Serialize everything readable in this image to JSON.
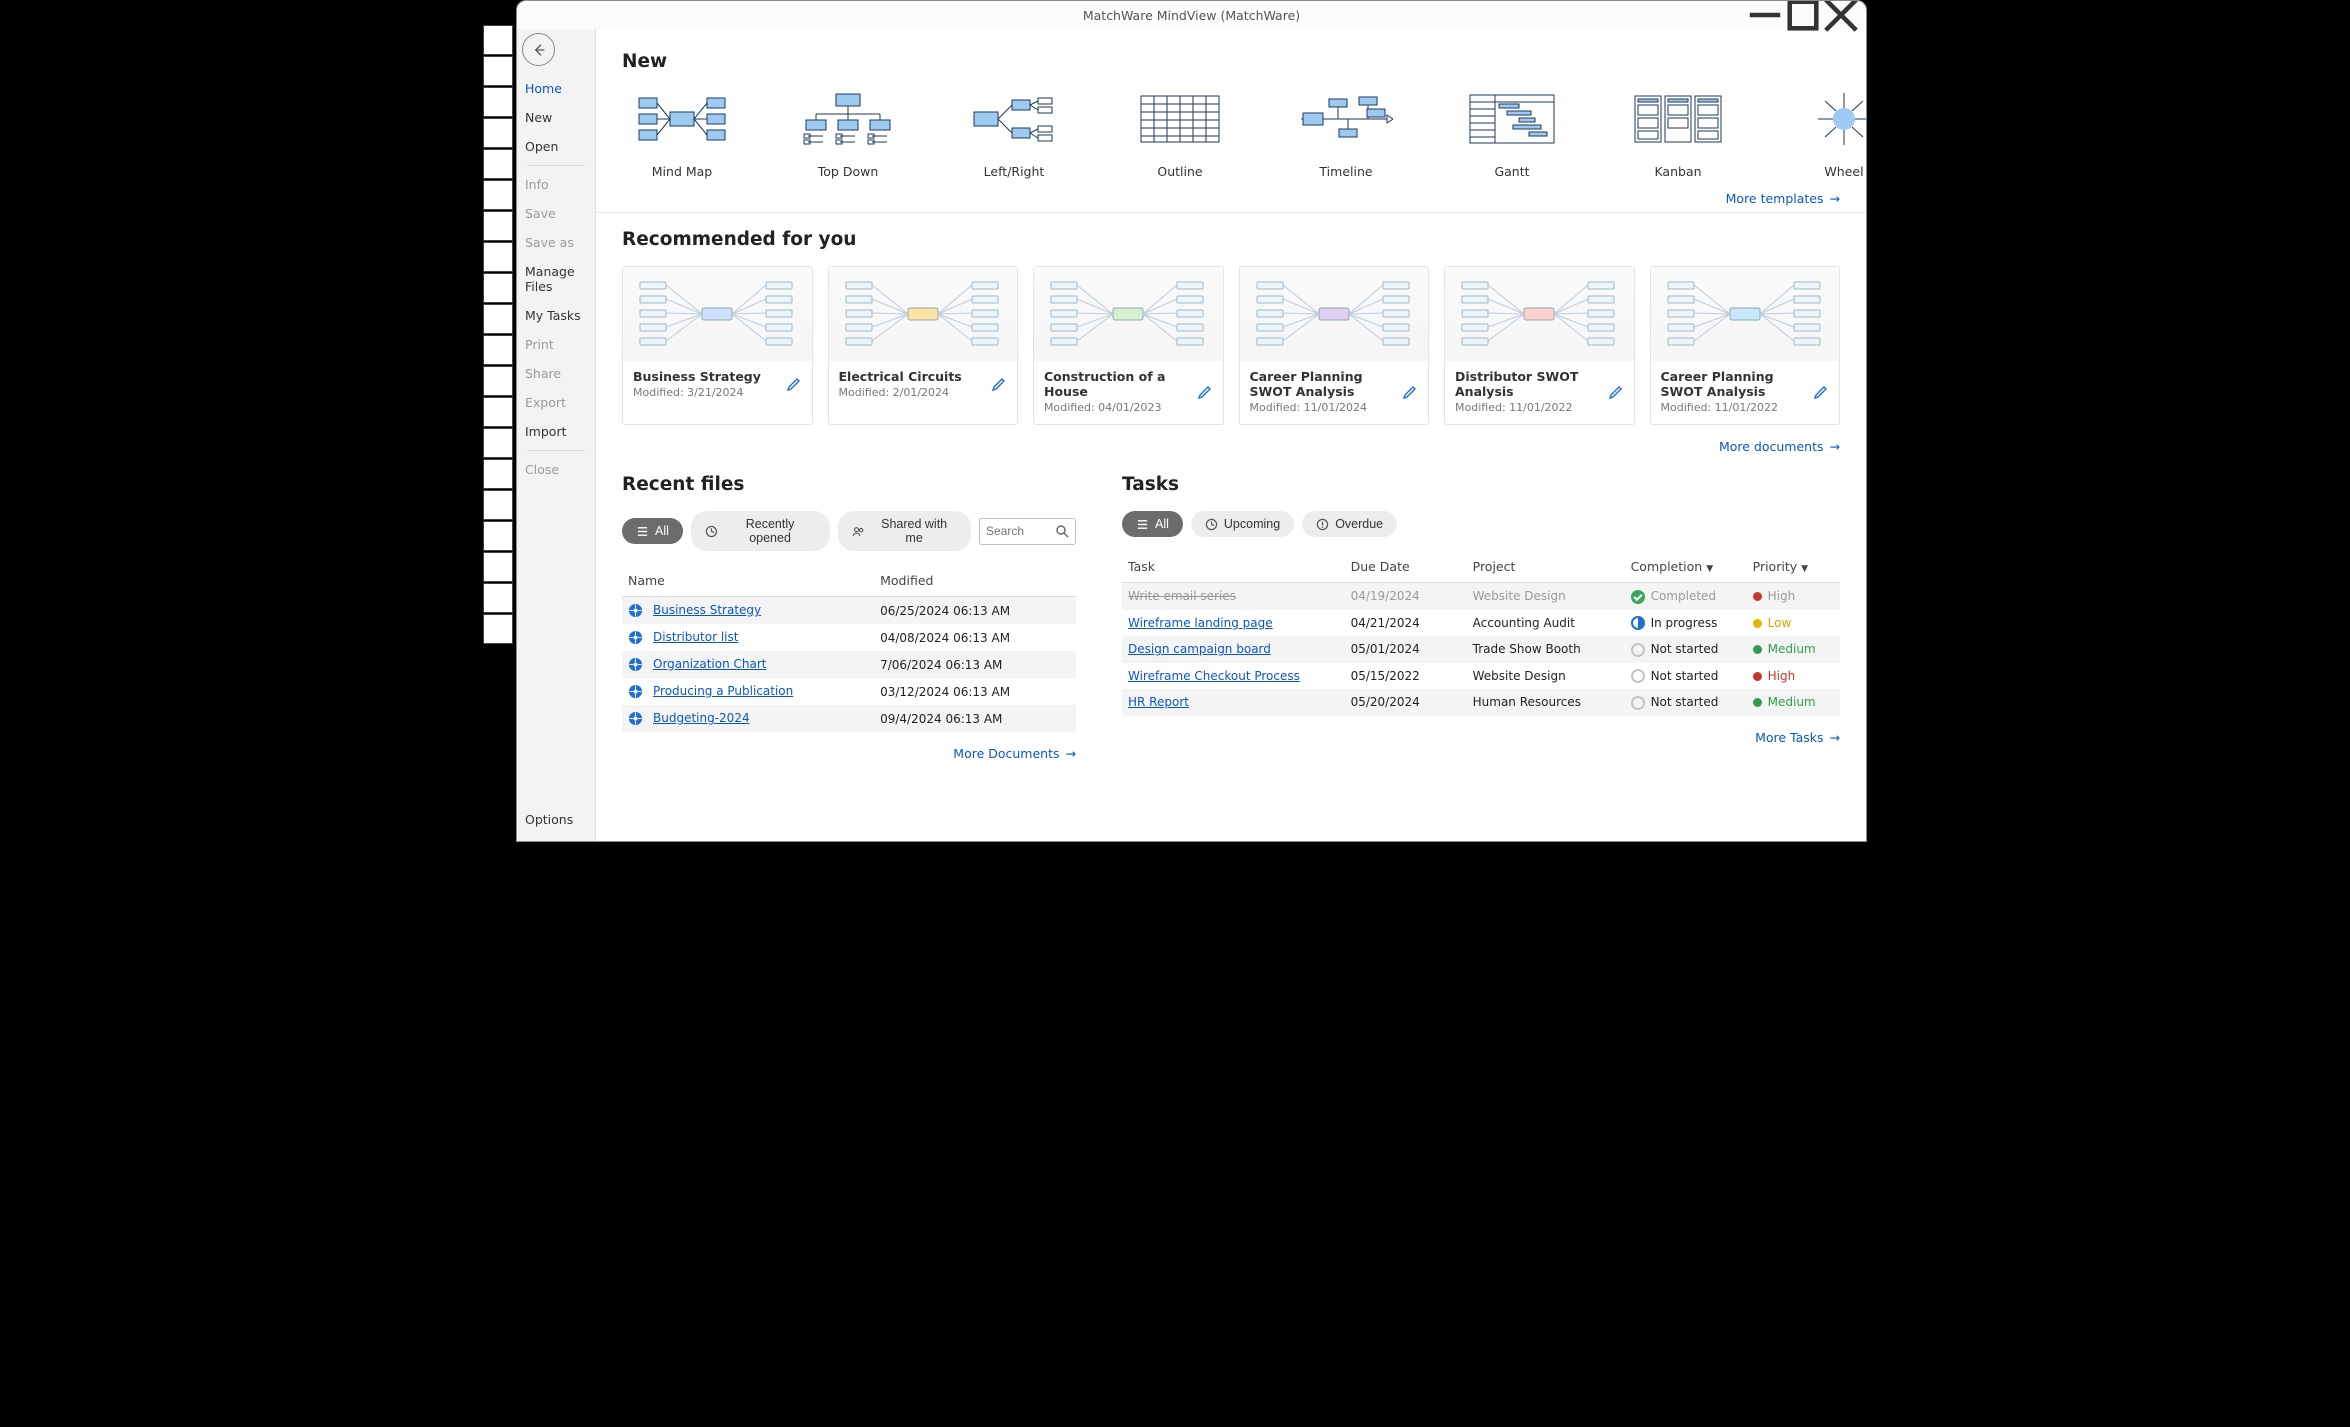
{
  "titlebar": {
    "title": "MatchWare MindView (MatchWare)"
  },
  "nav": {
    "home": "Home",
    "new": "New",
    "open": "Open",
    "info": "Info",
    "save": "Save",
    "save_as": "Save as",
    "manage_files": "Manage Files",
    "my_tasks": "My Tasks",
    "print": "Print",
    "share": "Share",
    "export": "Export",
    "import": "Import",
    "close": "Close",
    "options": "Options"
  },
  "sections": {
    "new": "New",
    "recommended": "Recommended for you",
    "recent": "Recent files",
    "tasks": "Tasks"
  },
  "templates": [
    {
      "label": "Mind Map"
    },
    {
      "label": "Top Down"
    },
    {
      "label": "Left/Right"
    },
    {
      "label": "Outline"
    },
    {
      "label": "Timeline"
    },
    {
      "label": "Gantt"
    },
    {
      "label": "Kanban"
    },
    {
      "label": "Wheel"
    }
  ],
  "links": {
    "more_templates": "More templates",
    "more_documents_top": "More documents",
    "more_documents": "More Documents",
    "more_tasks": "More Tasks"
  },
  "recommended": [
    {
      "title": "Business Strategy",
      "modified": "Modified: 3/21/2024"
    },
    {
      "title": "Electrical Circuits",
      "modified": "Modified: 2/01/2024"
    },
    {
      "title": "Construction of a House",
      "modified": "Modified: 04/01/2023"
    },
    {
      "title": "Career Planning SWOT Analysis",
      "modified": "Modified: 11/01/2024"
    },
    {
      "title": "Distributor SWOT Analysis",
      "modified": "Modified: 11/01/2022"
    },
    {
      "title": "Career Planning SWOT Analysis",
      "modified": "Modified: 11/01/2022"
    }
  ],
  "recent_chips": {
    "all": "All",
    "recently": "Recently opened",
    "shared": "Shared with me"
  },
  "search": {
    "placeholder": "Search"
  },
  "recent_headers": {
    "name": "Name",
    "modified": "Modified"
  },
  "recent_files": [
    {
      "name": "Business Strategy",
      "modified": "06/25/2024 06:13 AM"
    },
    {
      "name": "Distributor list",
      "modified": "04/08/2024 06:13 AM"
    },
    {
      "name": "Organization Chart",
      "modified": "7/06/2024 06:13 AM"
    },
    {
      "name": "Producing a Publication",
      "modified": "03/12/2024 06:13 AM"
    },
    {
      "name": "Budgeting-2024",
      "modified": "09/4/2024 06:13 AM"
    }
  ],
  "task_chips": {
    "all": "All",
    "upcoming": "Upcoming",
    "overdue": "Overdue"
  },
  "task_headers": {
    "task": "Task",
    "due": "Due Date",
    "project": "Project",
    "completion": "Completion",
    "priority": "Priority"
  },
  "tasks": [
    {
      "name": "Write email series",
      "due": "04/19/2024",
      "project": "Website Design",
      "status": "Completed",
      "status_kind": "done",
      "priority": "High",
      "priority_kind": "high",
      "done": true
    },
    {
      "name": "Wireframe landing page",
      "due": "04/21/2024",
      "project": "Accounting Audit",
      "status": "In progress",
      "status_kind": "prog",
      "priority": "Low",
      "priority_kind": "low",
      "done": false
    },
    {
      "name": "Design campaign board",
      "due": "05/01/2024",
      "project": "Trade Show Booth",
      "status": "Not started",
      "status_kind": "not",
      "priority": "Medium",
      "priority_kind": "med",
      "done": false
    },
    {
      "name": "Wireframe Checkout Process",
      "due": "05/15/2022",
      "project": "Website Design",
      "status": "Not started",
      "status_kind": "not",
      "priority": "High",
      "priority_kind": "high",
      "done": false
    },
    {
      "name": "HR Report",
      "due": "05/20/2024",
      "project": "Human Resources",
      "status": "Not started",
      "status_kind": "not",
      "priority": "Medium",
      "priority_kind": "med",
      "done": false
    }
  ]
}
